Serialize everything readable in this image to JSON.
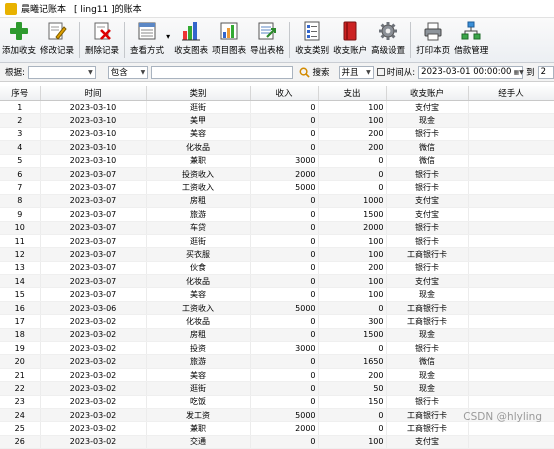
{
  "window": {
    "app_title": "晨曦记账本",
    "doc_title": "[ ling11 ]的账本"
  },
  "toolbar": [
    {
      "label": "添加收支",
      "icon": "add-icon"
    },
    {
      "label": "修改记录",
      "icon": "edit-icon"
    },
    {
      "label": "删除记录",
      "icon": "delete-icon"
    },
    {
      "label": "查看方式",
      "icon": "view-mode-icon"
    },
    {
      "label": "收支图表",
      "icon": "bar-chart-icon"
    },
    {
      "label": "项目图表",
      "icon": "project-chart-icon"
    },
    {
      "label": "导出表格",
      "icon": "export-icon"
    },
    {
      "label": "收支类别",
      "icon": "category-icon"
    },
    {
      "label": "收支账户",
      "icon": "account-book-icon"
    },
    {
      "label": "高级设置",
      "icon": "gear-icon"
    },
    {
      "label": "打印本页",
      "icon": "printer-icon"
    },
    {
      "label": "借款管理",
      "icon": "loan-network-icon"
    }
  ],
  "filter": {
    "by_label": "根据:",
    "by_value": "",
    "op_value": "包含",
    "keyword": "",
    "search_label": "搜索",
    "and_value": "并且",
    "time_from_label": "时间从:",
    "time_from_value": "2023-03-01 00:00:00",
    "to_label": "到",
    "time_to_value": "2"
  },
  "grid": {
    "columns": [
      "序号",
      "时间",
      "类别",
      "收入",
      "支出",
      "收支账户",
      "经手人"
    ],
    "rows": [
      [
        "1",
        "2023-03-10",
        "逛街",
        "0",
        "100",
        "支付宝",
        ""
      ],
      [
        "2",
        "2023-03-10",
        "美甲",
        "0",
        "100",
        "现金",
        ""
      ],
      [
        "3",
        "2023-03-10",
        "美容",
        "0",
        "200",
        "银行卡",
        ""
      ],
      [
        "4",
        "2023-03-10",
        "化妆品",
        "0",
        "200",
        "微信",
        ""
      ],
      [
        "5",
        "2023-03-10",
        "兼职",
        "3000",
        "0",
        "微信",
        ""
      ],
      [
        "6",
        "2023-03-07",
        "投资收入",
        "2000",
        "0",
        "银行卡",
        ""
      ],
      [
        "7",
        "2023-03-07",
        "工资收入",
        "5000",
        "0",
        "银行卡",
        ""
      ],
      [
        "8",
        "2023-03-07",
        "房租",
        "0",
        "1000",
        "支付宝",
        ""
      ],
      [
        "9",
        "2023-03-07",
        "旅游",
        "0",
        "1500",
        "支付宝",
        ""
      ],
      [
        "10",
        "2023-03-07",
        "车贷",
        "0",
        "2000",
        "银行卡",
        ""
      ],
      [
        "11",
        "2023-03-07",
        "逛街",
        "0",
        "100",
        "银行卡",
        ""
      ],
      [
        "12",
        "2023-03-07",
        "买衣服",
        "0",
        "100",
        "工商银行卡",
        ""
      ],
      [
        "13",
        "2023-03-07",
        "伙食",
        "0",
        "200",
        "银行卡",
        ""
      ],
      [
        "14",
        "2023-03-07",
        "化妆品",
        "0",
        "100",
        "支付宝",
        ""
      ],
      [
        "15",
        "2023-03-07",
        "美容",
        "0",
        "100",
        "现金",
        ""
      ],
      [
        "16",
        "2023-03-06",
        "工资收入",
        "5000",
        "0",
        "工商银行卡",
        ""
      ],
      [
        "17",
        "2023-03-02",
        "化妆品",
        "0",
        "300",
        "工商银行卡",
        ""
      ],
      [
        "18",
        "2023-03-02",
        "房租",
        "0",
        "1500",
        "现金",
        ""
      ],
      [
        "19",
        "2023-03-02",
        "投资",
        "3000",
        "0",
        "银行卡",
        ""
      ],
      [
        "20",
        "2023-03-02",
        "旅游",
        "0",
        "1650",
        "微信",
        ""
      ],
      [
        "21",
        "2023-03-02",
        "美容",
        "0",
        "200",
        "现金",
        ""
      ],
      [
        "22",
        "2023-03-02",
        "逛街",
        "0",
        "50",
        "现金",
        ""
      ],
      [
        "23",
        "2023-03-02",
        "吃饭",
        "0",
        "150",
        "银行卡",
        ""
      ],
      [
        "24",
        "2023-03-02",
        "发工资",
        "5000",
        "0",
        "工商银行卡",
        ""
      ],
      [
        "25",
        "2023-03-02",
        "兼职",
        "2000",
        "0",
        "工商银行卡",
        ""
      ],
      [
        "26",
        "2023-03-02",
        "交通",
        "0",
        "100",
        "支付宝",
        ""
      ]
    ]
  },
  "watermark": "CSDN @hlyling"
}
